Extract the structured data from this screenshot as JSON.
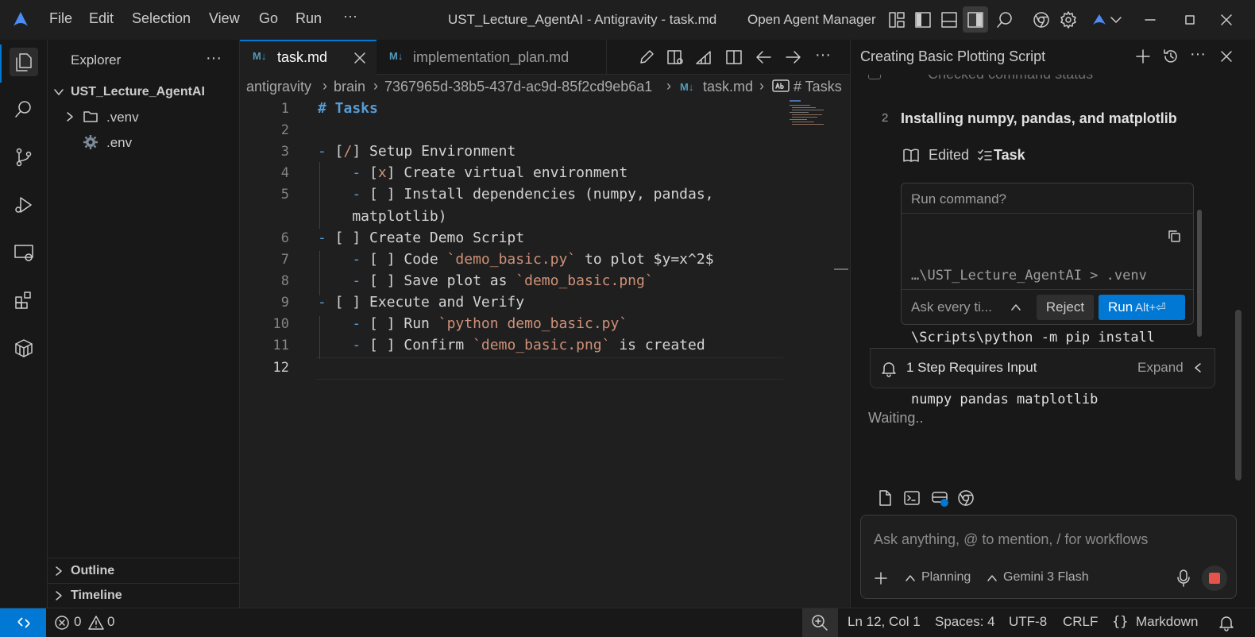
{
  "titlebar": {
    "menus": [
      "File",
      "Edit",
      "Selection",
      "View",
      "Go",
      "Run",
      "···"
    ],
    "window_title": "UST_Lecture_AgentAI - Antigravity - task.md",
    "agent_manager": "Open Agent Manager"
  },
  "explorer": {
    "title": "Explorer",
    "more": "···",
    "root": "UST_Lecture_AgentAI",
    "items": [
      {
        "label": ".venv",
        "icon": "folder-icon"
      },
      {
        "label": ".env",
        "icon": "gear-icon"
      }
    ],
    "outline": "Outline",
    "timeline": "Timeline"
  },
  "editor": {
    "tabs": [
      {
        "label": "task.md",
        "icon": "M↓",
        "active": true
      },
      {
        "label": "implementation_plan.md",
        "icon": "M↓",
        "active": false
      }
    ],
    "breadcrumb": [
      "antigravity",
      "brain",
      "7367965d-38b5-437d-ac9d-85f2cd9eb6a1",
      "task.md",
      "# Tasks"
    ],
    "breadcrumb_md_icon": "M↓",
    "lines": [
      {
        "n": "1",
        "text": "# Tasks"
      },
      {
        "n": "2",
        "text": ""
      },
      {
        "n": "3",
        "text": "- [/] Setup Environment"
      },
      {
        "n": "4",
        "text": "    - [x] Create virtual environment"
      },
      {
        "n": "5",
        "text": "    - [ ] Install dependencies (numpy, pandas,"
      },
      {
        "n": "",
        "text": "    matplotlib)"
      },
      {
        "n": "6",
        "text": "- [ ] Create Demo Script"
      },
      {
        "n": "7",
        "text": "    - [ ] Code `demo_basic.py` to plot $y=x^2$"
      },
      {
        "n": "8",
        "text": "    - [ ] Save plot as `demo_basic.png`"
      },
      {
        "n": "9",
        "text": "- [ ] Execute and Verify"
      },
      {
        "n": "10",
        "text": "    - [ ] Run `python demo_basic.py`"
      },
      {
        "n": "11",
        "text": "    - [ ] Confirm `demo_basic.png` is created"
      },
      {
        "n": "12",
        "text": ""
      }
    ]
  },
  "agent": {
    "title": "Creating Basic Plotting Script",
    "faded_step": "Checked command status",
    "step_number": "2",
    "step_title": "Installing numpy, pandas, and matplotlib",
    "edited": "Edited",
    "edited_target": "Task",
    "run_command_header": "Run command?",
    "command_line1": "…\\UST_Lecture_AgentAI > .venv",
    "command_line2": "\\Scripts\\python -m pip install",
    "command_line3": "numpy pandas matplotlib",
    "ask_every": "Ask every ti...",
    "reject": "Reject",
    "run": "Run",
    "run_shortcut": "Alt+⏎",
    "requires_input": "1 Step Requires Input",
    "expand": "Expand",
    "waiting": "Waiting..",
    "input_placeholder": "Ask anything, @ to mention, / for workflows",
    "planning": "Planning",
    "model": "Gemini 3 Flash"
  },
  "status": {
    "errors": "0",
    "warnings": "0",
    "position": "Ln 12, Col 1",
    "spaces": "Spaces: 4",
    "encoding": "UTF-8",
    "eol": "CRLF",
    "language": "Markdown"
  },
  "colors": {
    "accent": "#0078d4",
    "run_button": "#0e639c",
    "stop": "#e5534b",
    "string": "#ce9178",
    "heading": "#569cd6"
  }
}
